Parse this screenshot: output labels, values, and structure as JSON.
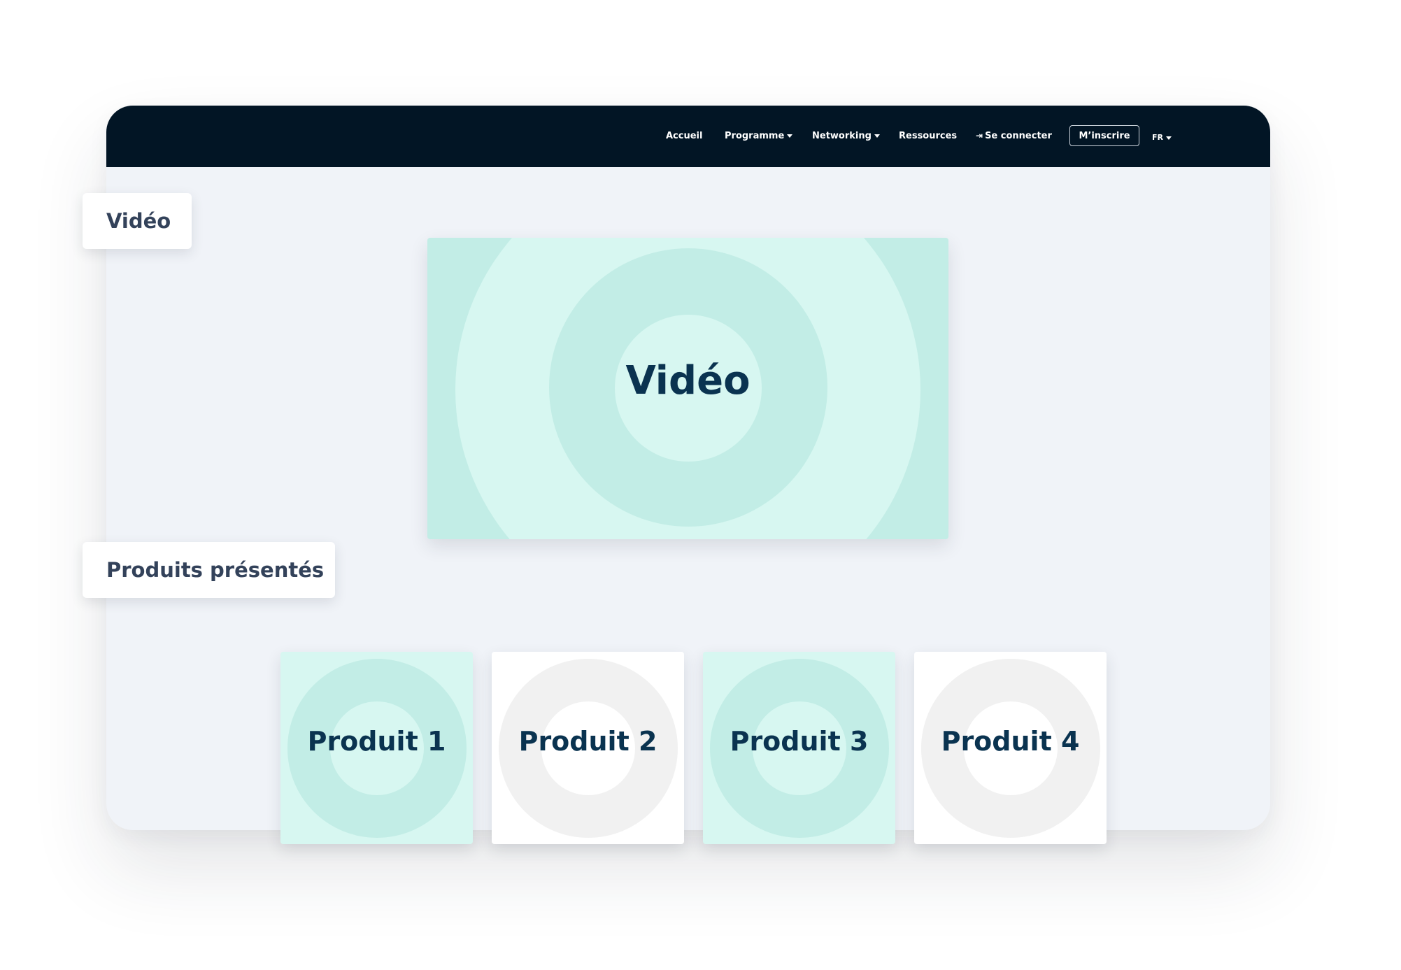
{
  "nav": {
    "items": [
      {
        "label": "Accueil"
      },
      {
        "label": "Programme",
        "icon": "caret-down-icon"
      },
      {
        "label": "Networking",
        "icon": "caret-down-icon"
      },
      {
        "label": "Ressources"
      },
      {
        "label": "Se connecter",
        "icon": "login-icon"
      }
    ],
    "signup_label": "M’inscrire",
    "language": "FR"
  },
  "labels": {
    "video": "Vidéo",
    "products": "Produits présentés"
  },
  "video": {
    "title": "Vidéo"
  },
  "products": [
    {
      "title": "Produit 1",
      "theme": "mint"
    },
    {
      "title": "Produit 2",
      "theme": "grey"
    },
    {
      "title": "Produit 3",
      "theme": "mint"
    },
    {
      "title": "Produit 4",
      "theme": "grey"
    }
  ],
  "colors": {
    "navbar": "#021525",
    "page_background": "#f0f3f8",
    "mint_light": "#d7f7f1",
    "mint_dark": "#c2ede6",
    "grey_light": "#f1f1f1",
    "title_text": "#0a3350",
    "label_text": "#33425a"
  }
}
